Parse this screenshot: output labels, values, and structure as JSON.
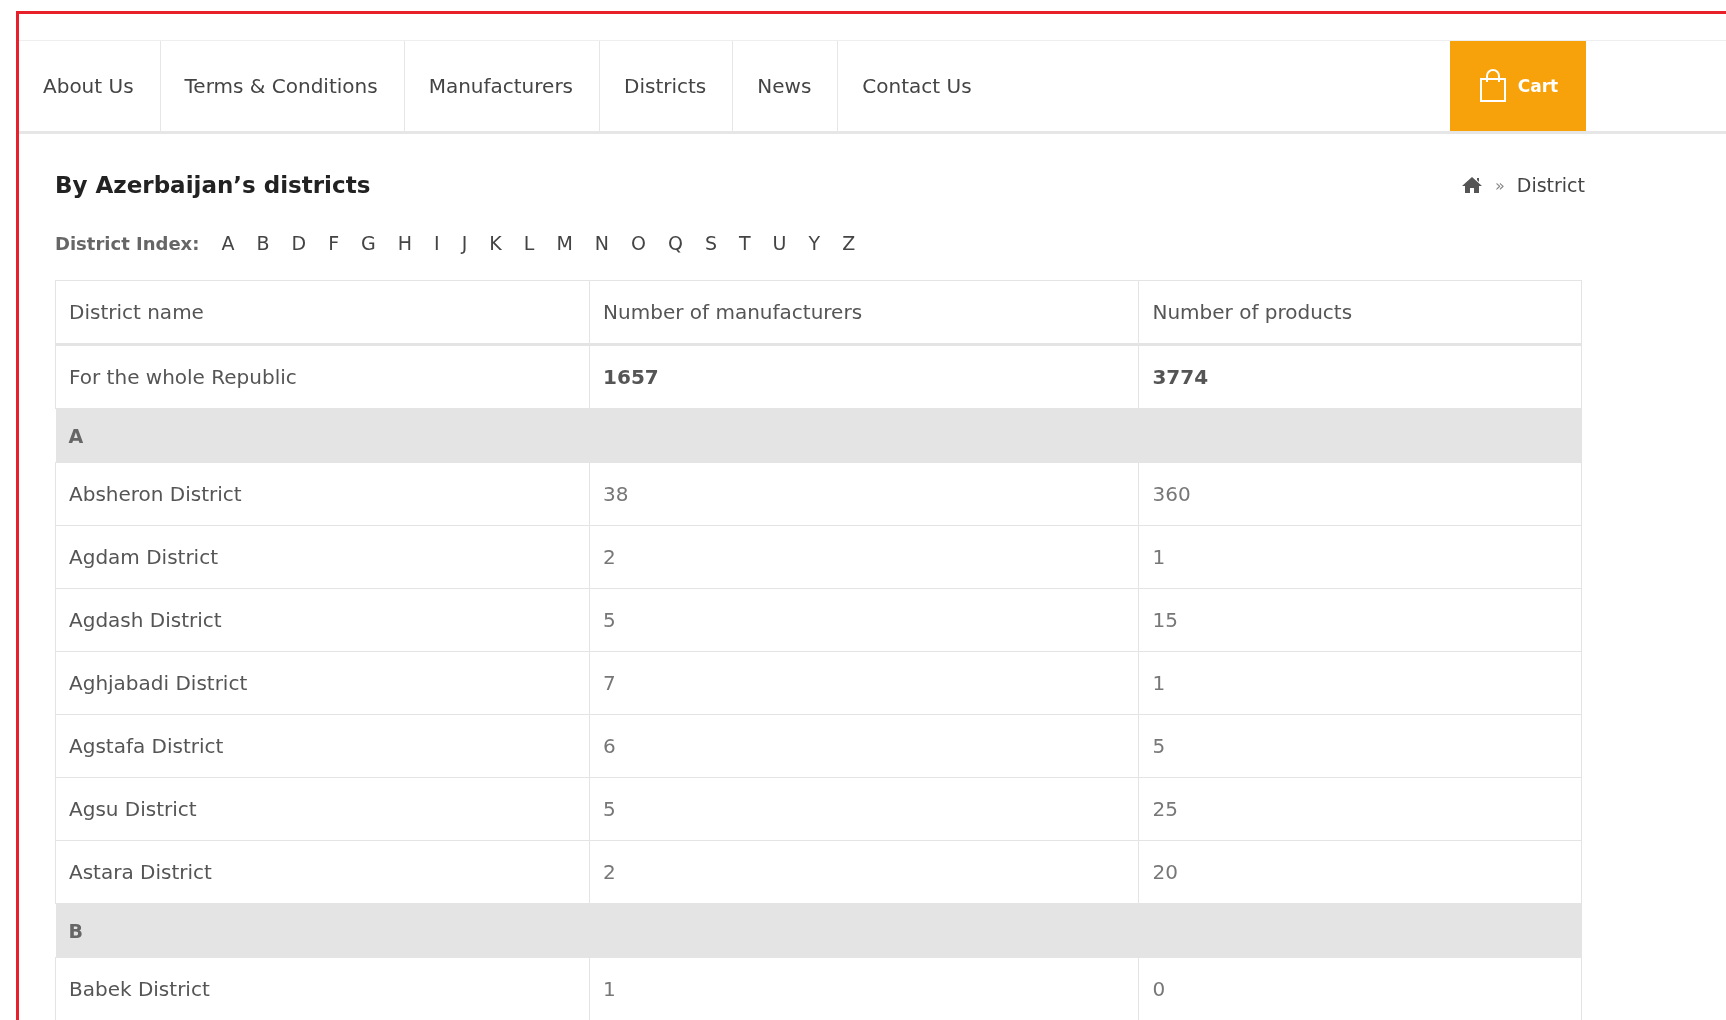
{
  "nav": {
    "items": [
      "About Us",
      "Terms & Conditions",
      "Manufacturers",
      "Districts",
      "News",
      "Contact Us"
    ],
    "cart": "Cart"
  },
  "page_title": "By Azerbaijan’s districts",
  "breadcrumb": {
    "current": "District",
    "separator": "»"
  },
  "district_index": {
    "label": "District Index:",
    "letters": [
      "A",
      "B",
      "D",
      "F",
      "G",
      "H",
      "I",
      "J",
      "K",
      "L",
      "M",
      "N",
      "O",
      "Q",
      "S",
      "T",
      "U",
      "Y",
      "Z"
    ]
  },
  "table": {
    "columns": [
      "District name",
      "Number of manufacturers",
      "Number of products"
    ],
    "rows": [
      {
        "kind": "total",
        "cells": [
          "For the whole Republic",
          "1657",
          "3774"
        ]
      },
      {
        "kind": "group",
        "cells": [
          "A"
        ]
      },
      {
        "kind": "district",
        "cells": [
          "Absheron District",
          "38",
          "360"
        ]
      },
      {
        "kind": "district",
        "cells": [
          "Agdam District",
          "2",
          "1"
        ]
      },
      {
        "kind": "district",
        "cells": [
          "Agdash District",
          "5",
          "15"
        ]
      },
      {
        "kind": "district",
        "cells": [
          "Aghjabadi District",
          "7",
          "1"
        ]
      },
      {
        "kind": "district",
        "cells": [
          "Agstafa District",
          "6",
          "5"
        ]
      },
      {
        "kind": "district",
        "cells": [
          "Agsu District",
          "5",
          "25"
        ]
      },
      {
        "kind": "district",
        "cells": [
          "Astara District",
          "2",
          "20"
        ]
      },
      {
        "kind": "group",
        "cells": [
          "B"
        ]
      },
      {
        "kind": "district",
        "cells": [
          "Babek District",
          "1",
          "0"
        ]
      }
    ]
  }
}
